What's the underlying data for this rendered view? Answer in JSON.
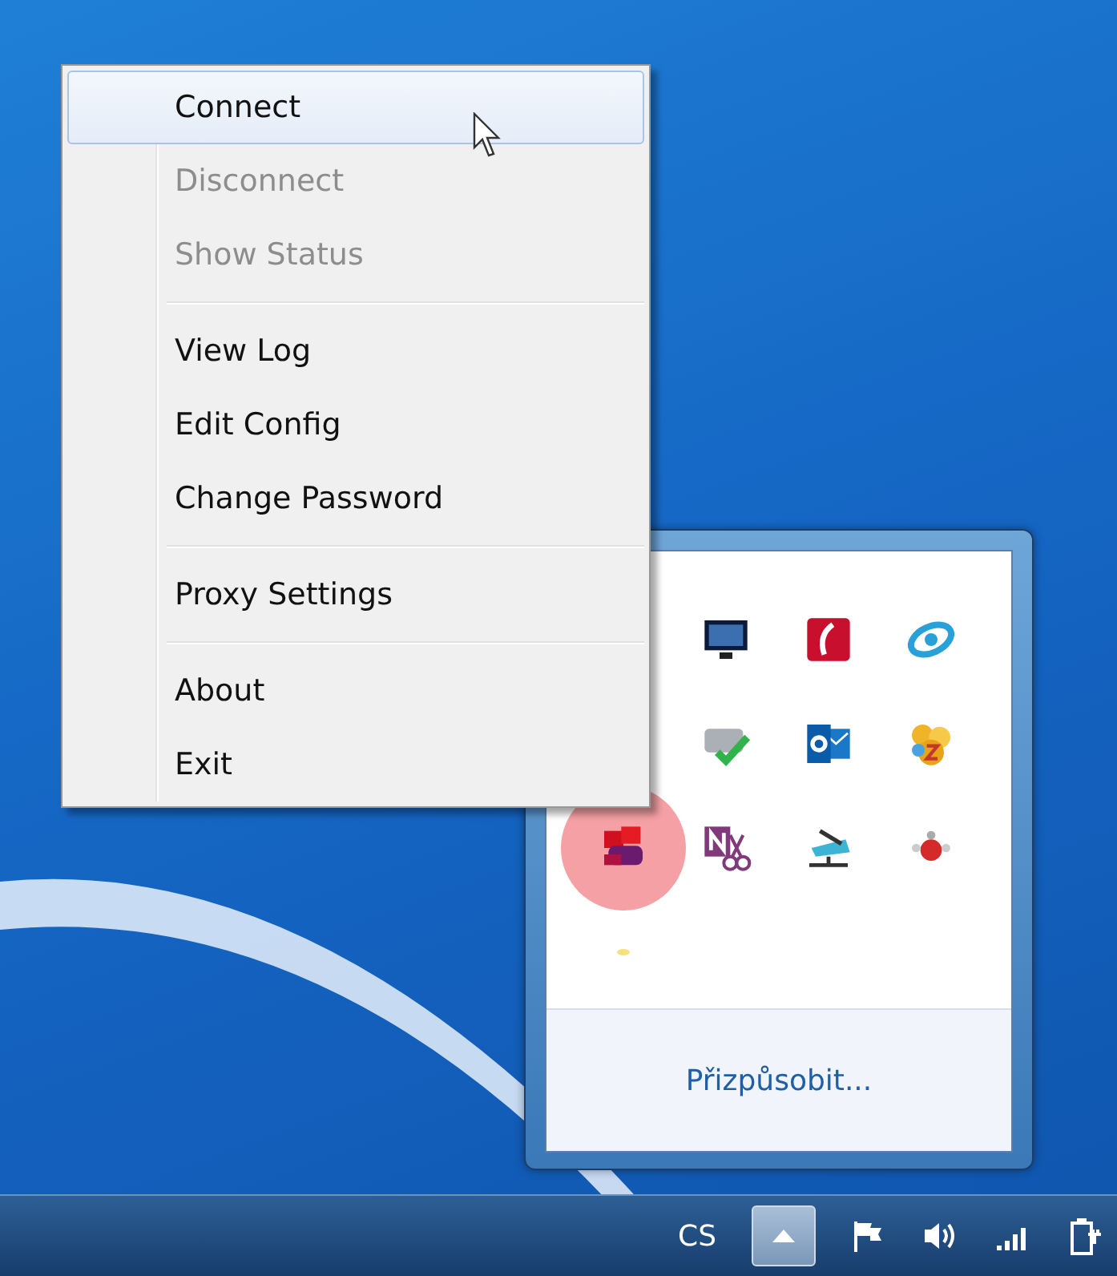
{
  "context_menu": {
    "groups": [
      {
        "items": [
          {
            "label": "Connect",
            "disabled": false,
            "selected": true
          },
          {
            "label": "Disconnect",
            "disabled": true,
            "selected": false
          },
          {
            "label": "Show Status",
            "disabled": true,
            "selected": false
          }
        ]
      },
      {
        "items": [
          {
            "label": "View Log",
            "disabled": false,
            "selected": false
          },
          {
            "label": "Edit Config",
            "disabled": false,
            "selected": false
          },
          {
            "label": "Change Password",
            "disabled": false,
            "selected": false
          }
        ]
      },
      {
        "items": [
          {
            "label": "Proxy Settings",
            "disabled": false,
            "selected": false
          }
        ]
      },
      {
        "items": [
          {
            "label": "About",
            "disabled": false,
            "selected": false
          },
          {
            "label": "Exit",
            "disabled": false,
            "selected": false
          }
        ]
      }
    ]
  },
  "tray_popup": {
    "icons": [
      {
        "kind": "monitor",
        "highlighted": false
      },
      {
        "kind": "red-app",
        "highlighted": false
      },
      {
        "kind": "swirl",
        "highlighted": false
      },
      {
        "kind": "drive-check",
        "highlighted": false
      },
      {
        "kind": "mail",
        "highlighted": false
      },
      {
        "kind": "cluster",
        "highlighted": false
      },
      {
        "kind": "cubes",
        "highlighted": true
      },
      {
        "kind": "note",
        "highlighted": false
      },
      {
        "kind": "scanner",
        "highlighted": false
      },
      {
        "kind": "bug",
        "highlighted": false
      },
      {
        "kind": "dot",
        "highlighted": false
      }
    ],
    "customize_link": "Přizpůsobit..."
  },
  "taskbar": {
    "language": "CS",
    "overflow_button": {
      "selected": true
    }
  }
}
